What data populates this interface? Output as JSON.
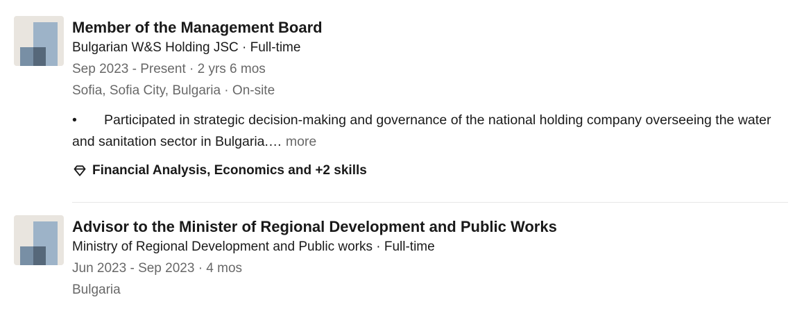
{
  "experience": [
    {
      "title": "Member of the Management Board",
      "company": "Bulgarian W&S Holding JSC · Full-time",
      "dates": "Sep 2023 - Present · 2 yrs 6 mos",
      "location": "Sofia, Sofia City, Bulgaria · On-site",
      "description_bullet": "•",
      "description": "Participated in strategic decision-making and governance of the national holding company overseeing the water and sanitation sector in Bulgaria.…",
      "more_label": " more",
      "skills": "Financial Analysis, Economics and +2 skills",
      "logo_icon": "company-logo-icon",
      "skills_icon": "diamond-icon"
    },
    {
      "title": "Advisor to the Minister of Regional Development and Public Works",
      "company": "Ministry of Regional Development and Public works · Full-time",
      "dates": "Jun 2023 - Sep 2023 · 4 mos",
      "location": "Bulgaria",
      "logo_icon": "company-logo-icon"
    }
  ],
  "colors": {
    "text_primary": "#191919",
    "text_secondary": "#666666",
    "logo_bg": "#e9e5df",
    "logo_light": "#9db3c8",
    "logo_mid": "#788fa5",
    "logo_dark": "#56687a",
    "divider": "#e6e6e6"
  }
}
